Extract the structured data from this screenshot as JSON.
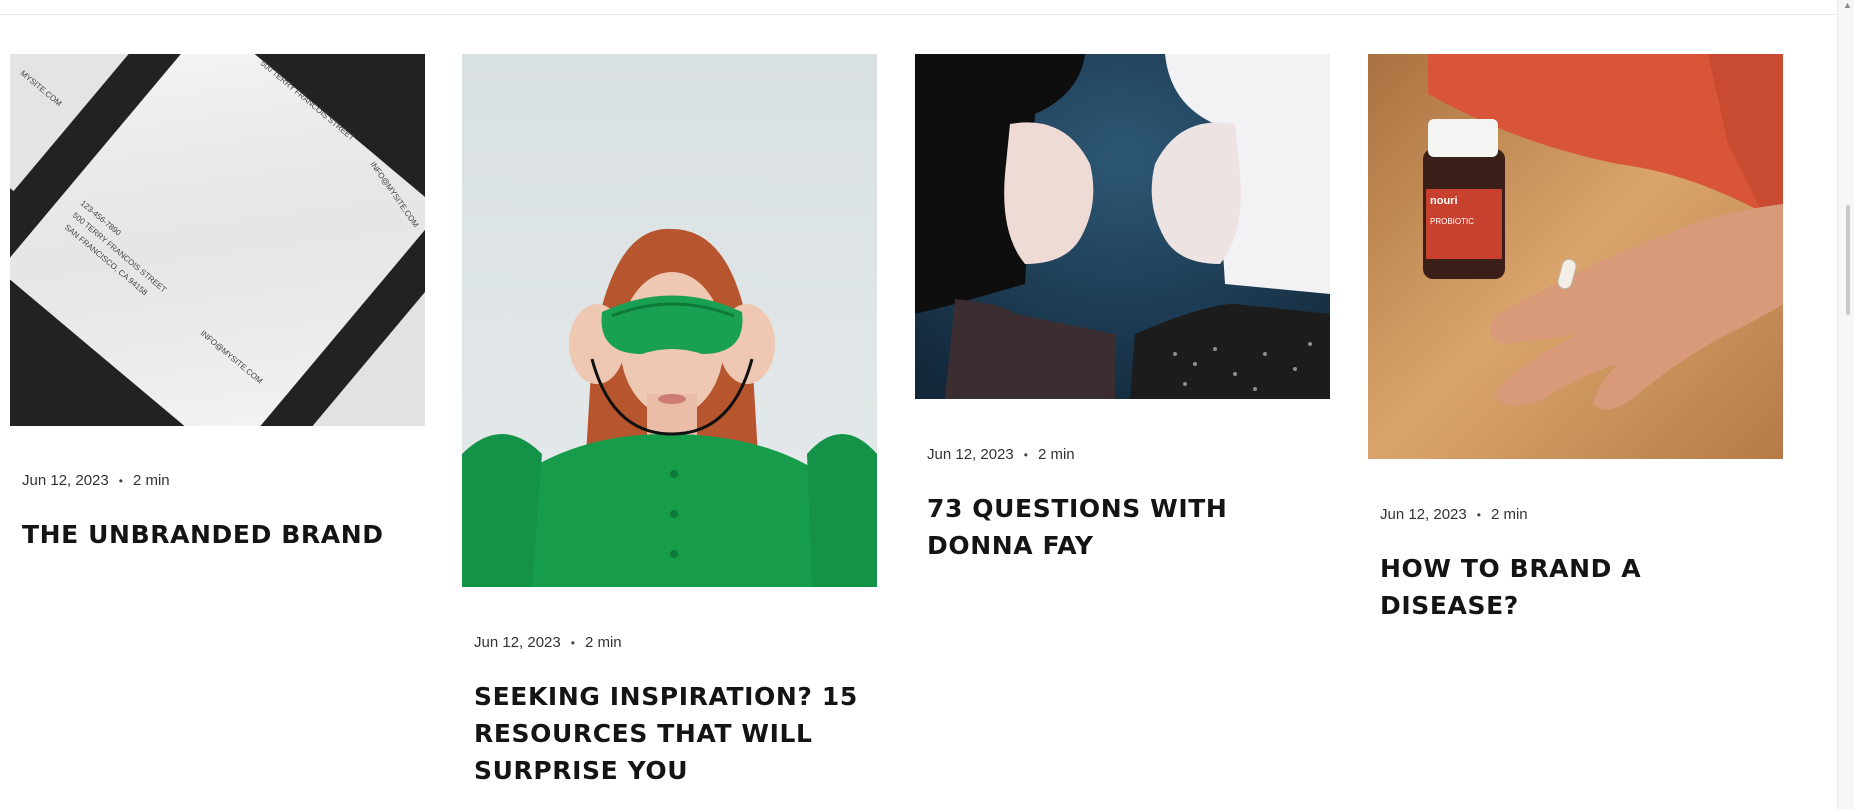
{
  "posts": [
    {
      "date": "Jun 12, 2023",
      "separator": "•",
      "read_time": "2 min",
      "title": "THE UNBRANDED BRAND",
      "image_label": "Business card mockup"
    },
    {
      "date": "Jun 12, 2023",
      "separator": "•",
      "read_time": "2 min",
      "title": "SEEKING INSPIRATION? 15 RESOURCES THAT WILL SURPRISE YOU",
      "image_label": "Woman with green eye mask"
    },
    {
      "date": "Jun 12, 2023",
      "separator": "•",
      "read_time": "2 min",
      "title": "73 QUESTIONS WITH DONNA FAY",
      "image_label": "Two women facing each other"
    },
    {
      "date": "Jun 12, 2023",
      "separator": "•",
      "read_time": "2 min",
      "title": "HOW TO BRAND A DISEASE?",
      "image_label": "Hand holding a capsule"
    }
  ],
  "card_texts": {
    "line1": "123-456-7890",
    "line2": "500 TERRY FRANCOIS STREET",
    "line3": "SAN FRANCISCO, CA 94158",
    "email": "INFO@MYSITE.COM",
    "site": "MYSITE.COM"
  },
  "bottle_brand": "nouri",
  "bottle_label": "PROBIOTIC",
  "colors": {
    "accent_green": "#169c4a",
    "bottle_orange": "#d8553a",
    "background": "#ffffff"
  }
}
